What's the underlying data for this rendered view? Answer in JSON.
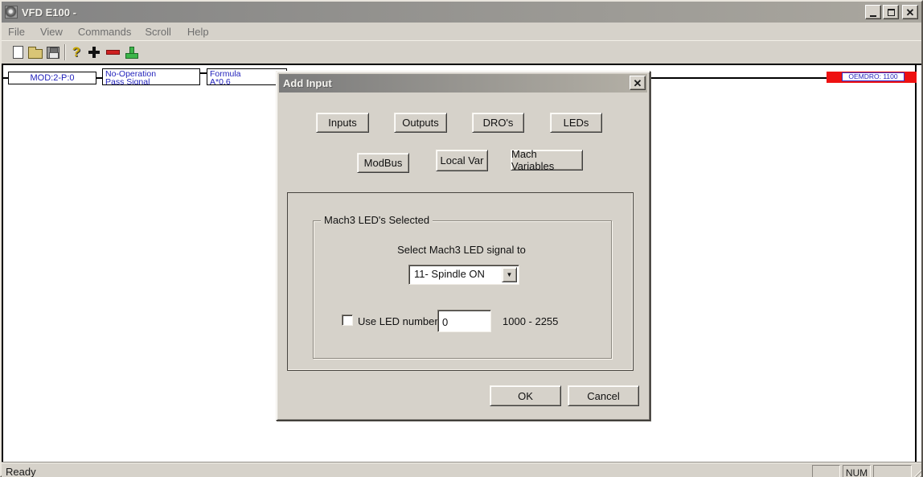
{
  "window": {
    "title": "VFD E100 -"
  },
  "menubar": {
    "items": [
      "File",
      "View",
      "Commands",
      "Scroll",
      "Help"
    ]
  },
  "toolbar": {
    "icons": [
      "new-document",
      "open-folder",
      "save",
      "help",
      "add-element",
      "remove-element",
      "ground-element"
    ]
  },
  "glyphs": {
    "close_x": "✕",
    "question": "?",
    "dropdown_arrow": "▼"
  },
  "ladder": {
    "module_box": "MOD:2-P:0",
    "operation_box": [
      "No-Operation",
      "Pass Signal"
    ],
    "formula_box": [
      "Formula",
      "A*0.6"
    ],
    "output_dro": "OEMDRO: 1100"
  },
  "dialog": {
    "title": "Add Input",
    "buttons_row1": [
      "Inputs",
      "Outputs",
      "DRO's",
      "LEDs"
    ],
    "buttons_row2": [
      "ModBus",
      "Local Var",
      "Mach Variables"
    ],
    "group_legend": "Mach3 LED's Selected",
    "select_label": "Select Mach3 LED signal to",
    "combo_value": "11- Spindle ON",
    "use_led_label": "Use LED number",
    "led_number_value": "0",
    "range_label": "1000 - 2255",
    "ok_label": "OK",
    "cancel_label": "Cancel"
  },
  "statusbar": {
    "message": "Ready",
    "num_indicator": "NUM"
  },
  "colors": {
    "window_bg": "#d6d2ca",
    "client_bg": "#ffffff",
    "titlebar_start": "#838383",
    "titlebar_end": "#aaa79f",
    "ladder_text": "#2222bb",
    "dro_red": "#ee1111"
  }
}
